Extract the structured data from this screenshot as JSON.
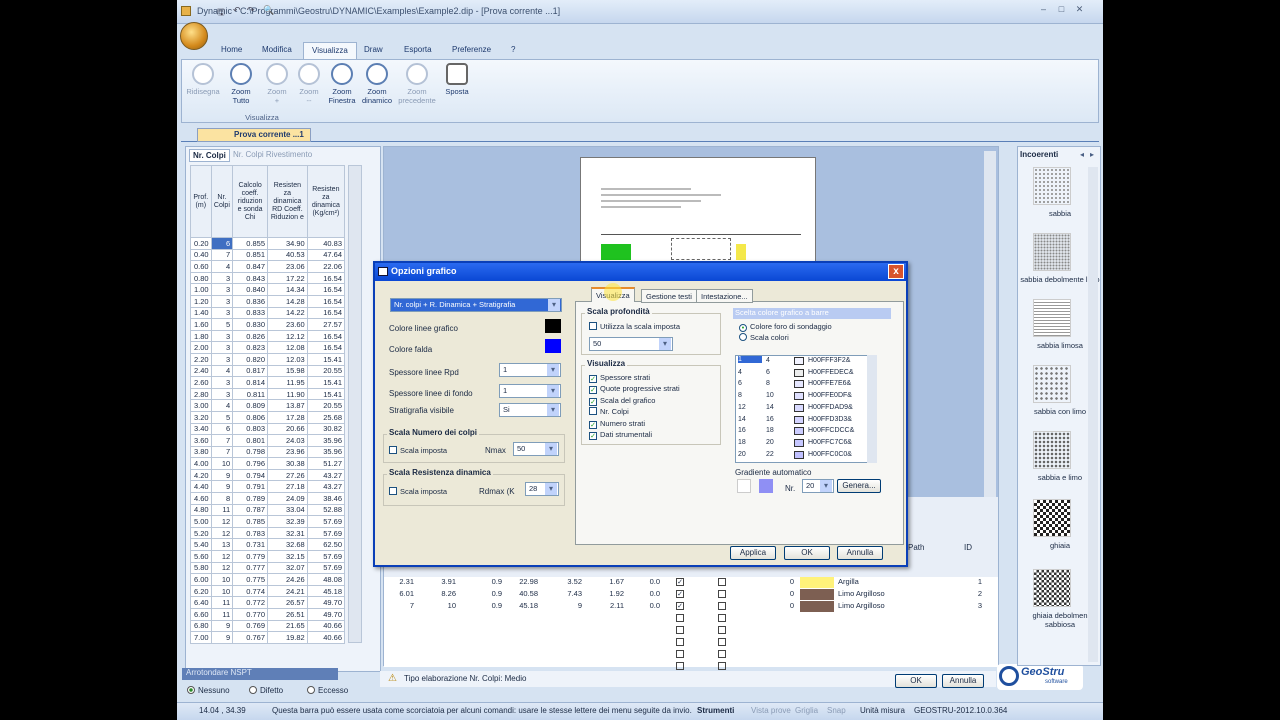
{
  "app": {
    "title": "Dynamic - C:\\Programmi\\Geostru\\DYNAMIC\\Examples\\Example2.dip - [Prova corrente ...1]"
  },
  "ribbon": {
    "tabs": [
      "Home",
      "Modifica",
      "Visualizza",
      "Draw",
      "Esporta",
      "Preferenze",
      "?"
    ],
    "active": "Visualizza",
    "buttons": [
      {
        "l1": "Ridisegna",
        "l2": ""
      },
      {
        "l1": "Zoom",
        "l2": "Tutto"
      },
      {
        "l1": "Zoom",
        "l2": "+"
      },
      {
        "l1": "Zoom",
        "l2": "--"
      },
      {
        "l1": "Zoom",
        "l2": "Finestra"
      },
      {
        "l1": "Zoom",
        "l2": "dinamico"
      },
      {
        "l1": "Zoom",
        "l2": "precedente"
      },
      {
        "l1": "Sposta",
        "l2": ""
      }
    ],
    "group_label": "Visualizza"
  },
  "doc_tab": "Prova corrente ...1",
  "left": {
    "tabs": [
      "Nr. Colpi",
      "Nr. Colpi Rivestimento"
    ],
    "headers": [
      "Prof. (m)",
      "Nr. Colpi",
      "Calcolo coeff. riduzion e sonda Chi",
      "Resisten za dinamica RD Coeff. Riduzion e",
      "Resisten za dinamica (Kg/cm²)"
    ],
    "rows": [
      [
        "0.20",
        "6",
        "0.855",
        "34.90",
        "40.83"
      ],
      [
        "0.40",
        "7",
        "0.851",
        "40.53",
        "47.64"
      ],
      [
        "0.60",
        "4",
        "0.847",
        "23.06",
        "22.06"
      ],
      [
        "0.80",
        "3",
        "0.843",
        "17.22",
        "16.54"
      ],
      [
        "1.00",
        "3",
        "0.840",
        "14.34",
        "16.54"
      ],
      [
        "1.20",
        "3",
        "0.836",
        "14.28",
        "16.54"
      ],
      [
        "1.40",
        "3",
        "0.833",
        "14.22",
        "16.54"
      ],
      [
        "1.60",
        "5",
        "0.830",
        "23.60",
        "27.57"
      ],
      [
        "1.80",
        "3",
        "0.826",
        "12.12",
        "16.54"
      ],
      [
        "2.00",
        "3",
        "0.823",
        "12.08",
        "16.54"
      ],
      [
        "2.20",
        "3",
        "0.820",
        "12.03",
        "15.41"
      ],
      [
        "2.40",
        "4",
        "0.817",
        "15.98",
        "20.55"
      ],
      [
        "2.60",
        "3",
        "0.814",
        "11.95",
        "15.41"
      ],
      [
        "2.80",
        "3",
        "0.811",
        "11.90",
        "15.41"
      ],
      [
        "3.00",
        "4",
        "0.809",
        "13.87",
        "20.55"
      ],
      [
        "3.20",
        "5",
        "0.806",
        "17.28",
        "25.68"
      ],
      [
        "3.40",
        "6",
        "0.803",
        "20.66",
        "30.82"
      ],
      [
        "3.60",
        "7",
        "0.801",
        "24.03",
        "35.96"
      ],
      [
        "3.80",
        "7",
        "0.798",
        "23.96",
        "35.96"
      ],
      [
        "4.00",
        "10",
        "0.796",
        "30.38",
        "51.27"
      ],
      [
        "4.20",
        "9",
        "0.794",
        "27.26",
        "43.27"
      ],
      [
        "4.40",
        "9",
        "0.791",
        "27.18",
        "43.27"
      ],
      [
        "4.60",
        "8",
        "0.789",
        "24.09",
        "38.46"
      ],
      [
        "4.80",
        "11",
        "0.787",
        "33.04",
        "52.88"
      ],
      [
        "5.00",
        "12",
        "0.785",
        "32.39",
        "57.69"
      ],
      [
        "5.20",
        "12",
        "0.783",
        "32.31",
        "57.69"
      ],
      [
        "5.40",
        "13",
        "0.731",
        "32.68",
        "62.50"
      ],
      [
        "5.60",
        "12",
        "0.779",
        "32.15",
        "57.69"
      ],
      [
        "5.80",
        "12",
        "0.777",
        "32.07",
        "57.69"
      ],
      [
        "6.00",
        "10",
        "0.775",
        "24.26",
        "48.08"
      ],
      [
        "6.20",
        "10",
        "0.774",
        "24.21",
        "45.18"
      ],
      [
        "6.40",
        "11",
        "0.772",
        "26.57",
        "49.70"
      ],
      [
        "6.60",
        "11",
        "0.770",
        "26.51",
        "49.70"
      ],
      [
        "6.80",
        "9",
        "0.769",
        "21.65",
        "40.66"
      ],
      [
        "7.00",
        "9",
        "0.767",
        "19.82",
        "40.66"
      ]
    ],
    "bottom_label": "Arrotondare NSPT",
    "radios": [
      "Nessuno",
      "Difetto",
      "Eccesso"
    ]
  },
  "warning": "Tipo elaborazione Nr. Colpi: Medio",
  "strata": {
    "headers": [
      "Path",
      "ID"
    ],
    "rows": [
      {
        "c": [
          "2.31",
          "3.91",
          "0.9",
          "22.98",
          "3.52",
          "1.67",
          "0.0"
        ],
        "n": "0",
        "color": "#fff27a",
        "name": "Argilla",
        "id": "1"
      },
      {
        "c": [
          "6.01",
          "8.26",
          "0.9",
          "40.58",
          "7.43",
          "1.92",
          "0.0"
        ],
        "n": "0",
        "color": "#7d5f52",
        "name": "Limo Argilloso",
        "id": "2"
      },
      {
        "c": [
          "7",
          "10",
          "0.9",
          "45.18",
          "9",
          "2.11",
          "0.0"
        ],
        "n": "0",
        "color": "#7d5f52",
        "name": "Limo Argilloso",
        "id": "3"
      }
    ]
  },
  "buttons": {
    "ok": "OK",
    "cancel": "Annulla"
  },
  "right": {
    "title": "Incoerenti",
    "items": [
      "sabbia",
      "sabbia debolmente limo",
      "sabbia limosa",
      "sabbia con limo",
      "sabbia e limo",
      "ghiaia",
      "ghiaia debolmen sabbiosa"
    ]
  },
  "logo": {
    "name": "GeoStru",
    "sub": "software"
  },
  "status": {
    "coords": "14.04 , 34.39",
    "hint": "Questa barra può essere usata come scorciatoia per alcuni comandi: usare le stesse lettere dei menu seguite da invio.",
    "items": [
      "Strumenti",
      "Vista prove",
      "Griglia",
      "Snap",
      "Unità misura",
      "GEOSTRU-2012.10.0.364"
    ]
  },
  "dialog": {
    "title": "Opzioni grafico",
    "close": "x",
    "tabs": [
      "Visualizza",
      "Gestione testi",
      "Intestazione..."
    ],
    "view_type": "Nr. colpi + R. Dinamica + Stratigrafia",
    "colore_linee": "Colore linee grafico",
    "colore_falda": "Colore falda",
    "spessore_rpd": "Spessore linee Rpd",
    "spessore_rpd_val": "1",
    "spessore_fondo": "Spessore linee di fondo",
    "spessore_fondo_val": "1",
    "strat_visibile": "Stratigrafia visibile",
    "strat_visibile_val": "Si",
    "scala_colpi": "Scala Numero dei colpi",
    "scala_imposta": "Scala imposta",
    "nmax": "Nmax",
    "nmax_val": "50",
    "scala_rd": "Scala Resistenza dinamica",
    "rdmax": "Rdmax (K",
    "rdmax_val": "28",
    "scala_prof": "Scala profondità",
    "utilizza": "Utilizza la scala imposta",
    "scala_val": "50",
    "visualizza": "Visualizza",
    "checks": [
      {
        "l": "Spessore strati",
        "v": "✓"
      },
      {
        "l": "Quote progressive strati",
        "v": "✓"
      },
      {
        "l": "Scala del grafico",
        "v": "✓"
      },
      {
        "l": "Nr. Colpi",
        "v": ""
      },
      {
        "l": "Numero strati",
        "v": "✓"
      },
      {
        "l": "Dati strumentali",
        "v": "✓"
      }
    ],
    "bar_title": "Scelta colore grafico a barre",
    "opt1": "Colore foro di sondaggio",
    "opt2": "Scala colori",
    "colors": [
      [
        "1",
        "4",
        "H00FFF3F2&",
        "#f2f3ff"
      ],
      [
        "4",
        "6",
        "H00FFEDEC&",
        "#eceded"
      ],
      [
        "6",
        "8",
        "H00FFE7E6&",
        "#e6e7ff"
      ],
      [
        "8",
        "10",
        "H00FFE0DF&",
        "#dfe0ff"
      ],
      [
        "12",
        "14",
        "H00FFDAD9&",
        "#d9daff"
      ],
      [
        "14",
        "16",
        "H00FFD3D3&",
        "#d3d3ff"
      ],
      [
        "16",
        "18",
        "H00FFCDCC&",
        "#cccdff"
      ],
      [
        "18",
        "20",
        "H00FFC7C6&",
        "#c6c7ff"
      ],
      [
        "20",
        "22",
        "H00FFC0C0&",
        "#c0c0ff"
      ]
    ],
    "gradient": "Gradiente automatico",
    "nr": "Nr.",
    "nr_val": "20",
    "genera": "Genera...",
    "applica": "Applica",
    "ok": "OK",
    "annulla": "Annulla"
  }
}
